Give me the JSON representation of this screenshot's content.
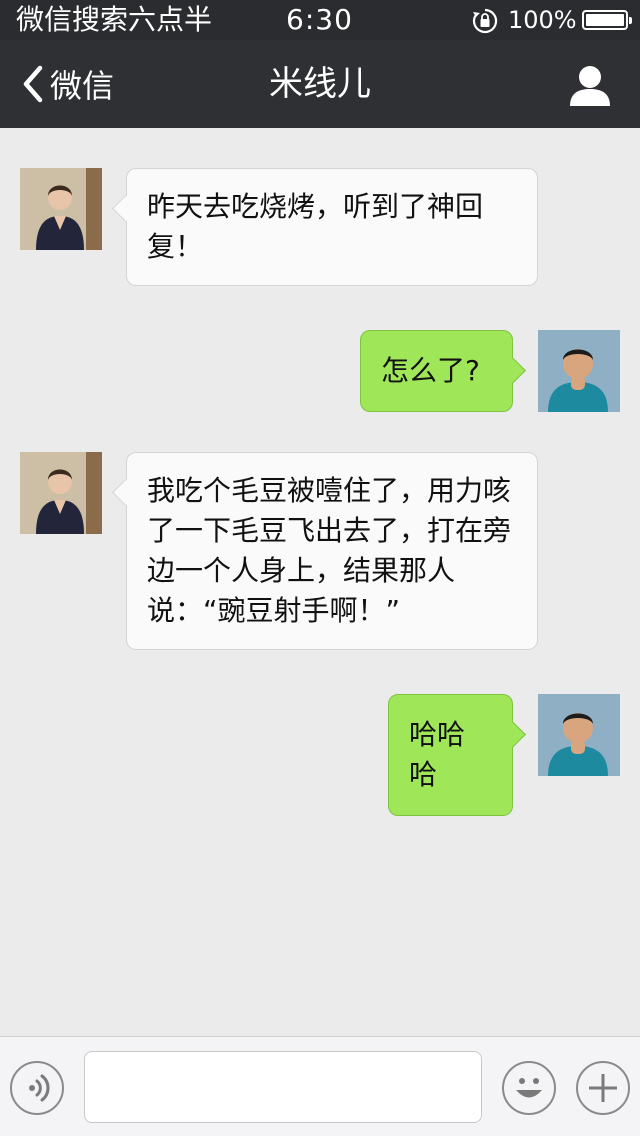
{
  "status_bar": {
    "carrier": "微信搜索六点半",
    "time": "6:30",
    "battery": "100%"
  },
  "nav": {
    "back_label": "微信",
    "title": "米线儿"
  },
  "messages": [
    {
      "side": "in",
      "text": "昨天去吃烧烤，听到了神回复！"
    },
    {
      "side": "out",
      "text": "怎么了?"
    },
    {
      "side": "in",
      "text": "我吃个毛豆被噎住了，用力咳了一下毛豆飞出去了，打在旁边一个人身上，结果那人说：“豌豆射手啊！”"
    },
    {
      "side": "out",
      "text": "哈哈哈"
    }
  ],
  "input": {
    "value": "",
    "placeholder": ""
  },
  "icons": {
    "voice": "voice-icon",
    "emoji": "emoji-icon",
    "plus": "plus-icon",
    "profile": "profile-icon",
    "back": "chevron-left-icon",
    "lock": "rotation-lock-icon",
    "battery": "battery-icon"
  },
  "colors": {
    "nav_bg": "#2e3033",
    "chat_bg": "#ebebeb",
    "outgoing_bubble": "#9fe658",
    "incoming_bubble": "#fafafa"
  }
}
